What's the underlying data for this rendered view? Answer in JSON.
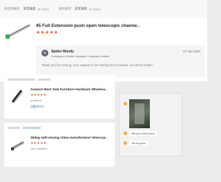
{
  "ratings_bar": [
    {
      "label": "供应商服务",
      "value": "非常满意",
      "count": "(5 stars)"
    },
    {
      "label": "按时发货",
      "value": "非常满意",
      "count": "(5 stars)"
    }
  ],
  "review": {
    "product_title": "45 Full Extension push open telescopic channe..",
    "stars": "★★★★★",
    "reply": {
      "name": "Spider Mondy",
      "company": "Guangzhou Spider Hardware Company Limited",
      "date": "07 Jan 2023",
      "text": "Thank you for coming, your support is our driving force forward, we will do better !"
    }
  },
  "cards": [
    {
      "title": "Amazon Best Sale Furniture Hardware Wholesa..",
      "stars": "★★★★★",
      "status": "excellent",
      "link": "回翻译评价"
    },
    {
      "title": "35deg self-closing china manufacturer telescop..",
      "stars": "★★★★★",
      "status": "very Satisfied",
      "link": ""
    }
  ],
  "chat": {
    "messages": [
      "Will you check them",
      "Yes its good"
    ]
  },
  "colors": {
    "star": "#e8622a",
    "link": "#3a78c9"
  }
}
